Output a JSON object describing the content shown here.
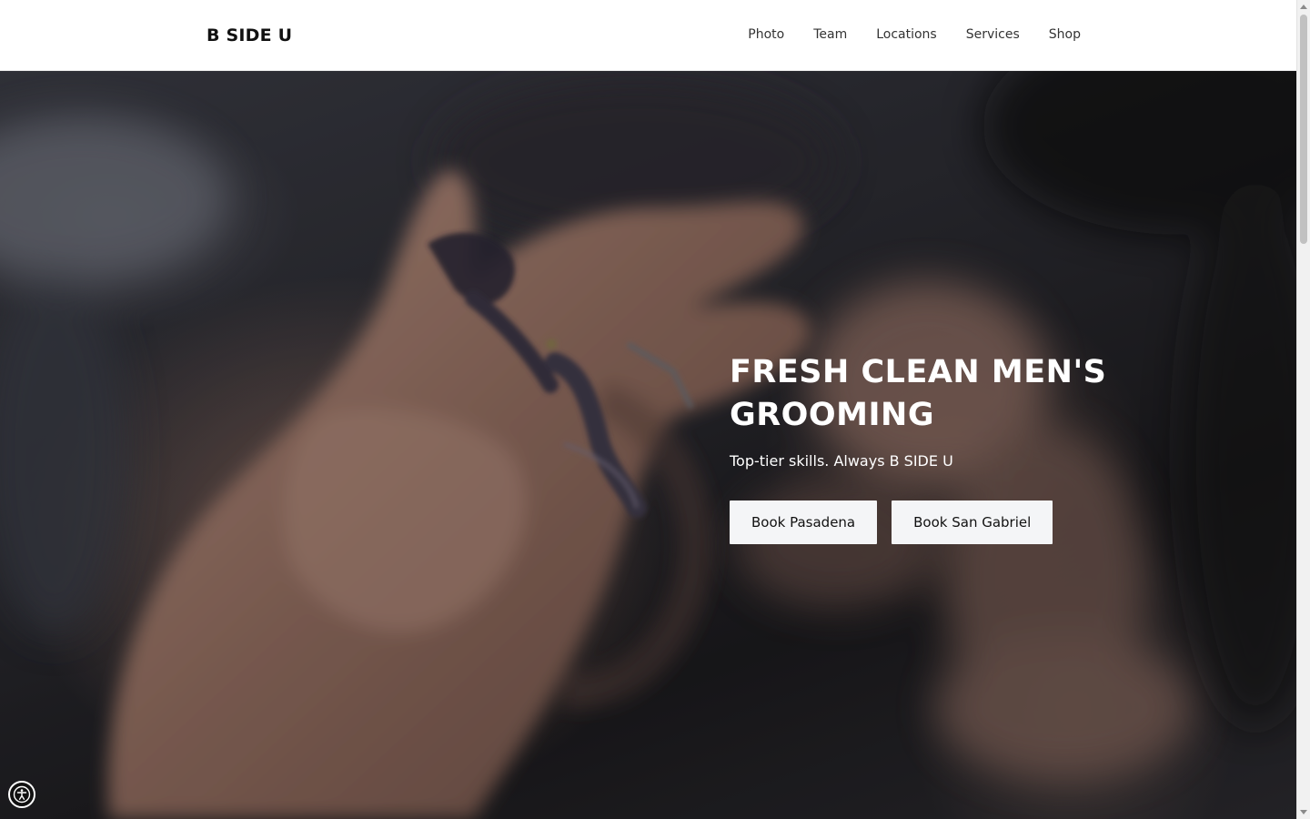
{
  "header": {
    "logo": "B SIDE U",
    "nav": [
      {
        "label": "Photo"
      },
      {
        "label": "Team"
      },
      {
        "label": "Locations"
      },
      {
        "label": "Services"
      },
      {
        "label": "Shop"
      }
    ]
  },
  "hero": {
    "title": "FRESH CLEAN MEN'S GROOMING",
    "subtitle": "Top-tier skills. Always B SIDE U",
    "buttons": [
      {
        "label": "Book Pasadena"
      },
      {
        "label": "Book San Gabriel"
      }
    ],
    "background_image": "blurred close-up of a hand holding barber scissors"
  },
  "accessibility_widget": {
    "icon": "accessibility-icon"
  },
  "colors": {
    "header_bg": "#ffffff",
    "hero_text": "#ffffff",
    "button_bg": "#f4f5f7",
    "button_text": "#111111",
    "nav_text": "#333333"
  }
}
